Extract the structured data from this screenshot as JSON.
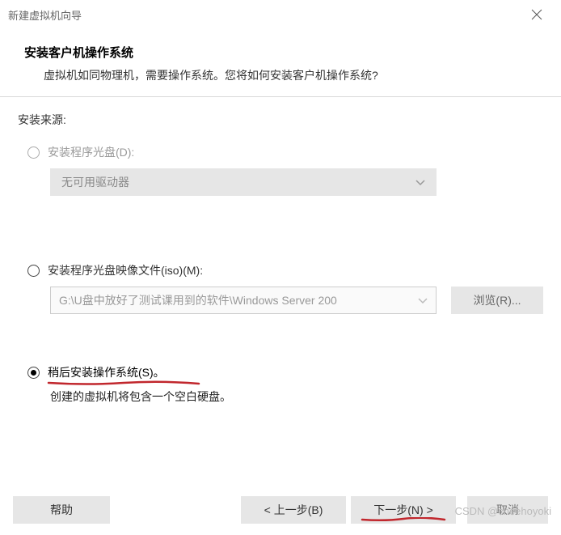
{
  "window": {
    "title": "新建虚拟机向导"
  },
  "header": {
    "title": "安装客户机操作系统",
    "description": "虚拟机如同物理机，需要操作系统。您将如何安装客户机操作系统?"
  },
  "source_label": "安装来源:",
  "options": {
    "disc": {
      "label": "安装程序光盘(D):",
      "dropdown_text": "无可用驱动器"
    },
    "iso": {
      "label": "安装程序光盘映像文件(iso)(M):",
      "path": "G:\\U盘中放好了测试课用到的软件\\Windows Server 200",
      "browse": "浏览(R)..."
    },
    "later": {
      "label": "稍后安装操作系统(S)。",
      "description": "创建的虚拟机将包含一个空白硬盘。"
    }
  },
  "footer": {
    "help": "帮助",
    "back": "< 上一步(B)",
    "next": "下一步(N) >",
    "cancel": "取消"
  },
  "watermark": "CSDN @cheehoyoki"
}
